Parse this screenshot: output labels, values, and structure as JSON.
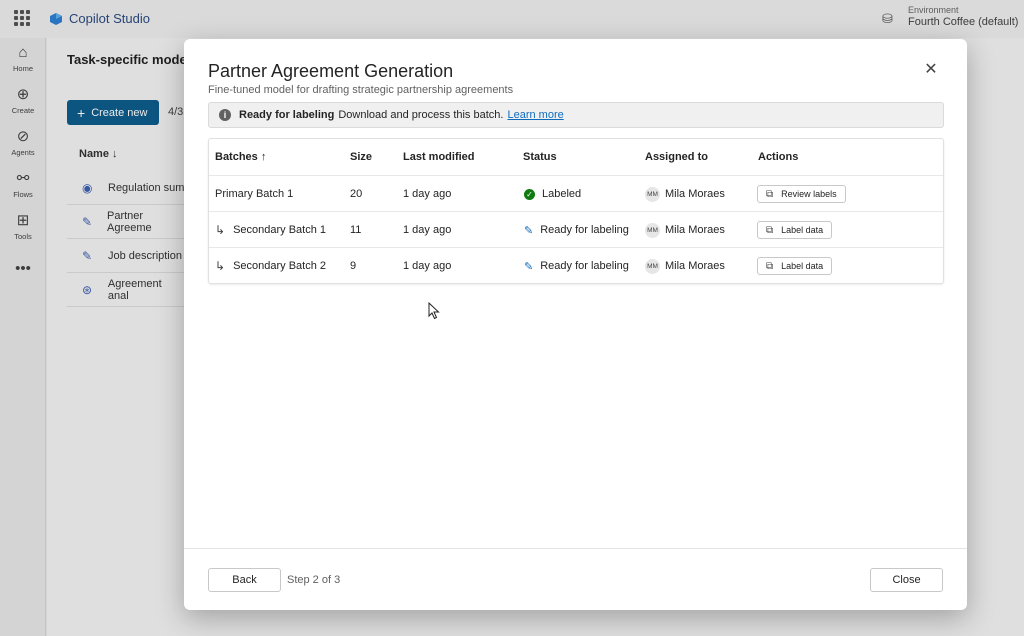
{
  "app": {
    "title": "Copilot Studio",
    "environment_label": "Environment",
    "environment_name": "Fourth Coffee (default)"
  },
  "leftnav": [
    {
      "label": "Home",
      "icon": "home-icon"
    },
    {
      "label": "Create",
      "icon": "plus-circle-icon"
    },
    {
      "label": "Agents",
      "icon": "agents-icon"
    },
    {
      "label": "Flows",
      "icon": "flows-icon"
    },
    {
      "label": "Tools",
      "icon": "tools-icon"
    }
  ],
  "background": {
    "page_title": "Task-specific models",
    "create_button": "Create new",
    "count": "4/3",
    "name_header": "Name ↓",
    "rows": [
      "Regulation sum",
      "Partner Agreeme",
      "Job description",
      "Agreement anal"
    ]
  },
  "dialog": {
    "title": "Partner Agreement Generation",
    "subtitle": "Fine-tuned model for drafting strategic partnership agreements",
    "info": {
      "strong": "Ready for labeling",
      "text": "Download and process this batch.",
      "link": "Learn more"
    },
    "table": {
      "headers": [
        "Batches ↑",
        "Size",
        "Last modified",
        "Status",
        "Assigned to",
        "Actions"
      ],
      "rows": [
        {
          "batch": "Primary Batch 1",
          "size": "20",
          "modified": "1 day ago",
          "status": "Labeled",
          "initials": "MM",
          "assignee": "Mila Moraes",
          "action": "Review labels"
        },
        {
          "batch": "Secondary Batch 1",
          "size": "11",
          "modified": "1 day ago",
          "status": "Ready for labeling",
          "initials": "MM",
          "assignee": "Mila Moraes",
          "action": "Label data"
        },
        {
          "batch": "Secondary Batch 2",
          "size": "9",
          "modified": "1 day ago",
          "status": "Ready for labeling",
          "initials": "MM",
          "assignee": "Mila Moraes",
          "action": "Label data"
        }
      ]
    },
    "footer": {
      "back": "Back",
      "step": "Step 2 of 3",
      "close": "Close"
    }
  },
  "colors": {
    "accent": "#0f6cbd",
    "create_button": "#0f5d8c",
    "labeled_status": "#107c10"
  }
}
